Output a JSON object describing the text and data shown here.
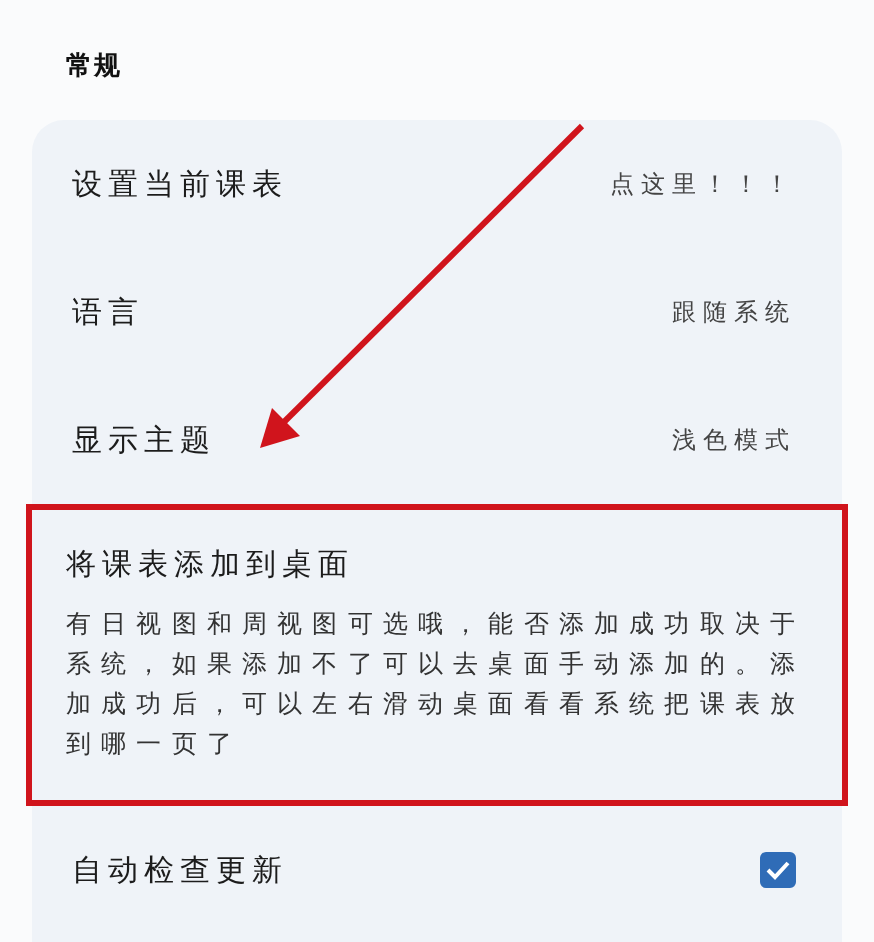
{
  "section": {
    "title": "常规"
  },
  "items": [
    {
      "kind": "value",
      "title": "设置当前课表",
      "value": "点这里！！！",
      "highlighted": false
    },
    {
      "kind": "value",
      "title": "语言",
      "value": "跟随系统",
      "highlighted": false
    },
    {
      "kind": "value",
      "title": "显示主题",
      "value": "浅色模式",
      "highlighted": false
    },
    {
      "kind": "description",
      "title": "将课表添加到桌面",
      "description": "有日视图和周视图可选哦，能否添加成功取决于系统，如果添加不了可以去桌面手动添加的。添加成功后，可以左右滑动桌面看看系统把课表放到哪一页了",
      "highlighted": true
    },
    {
      "kind": "checkbox",
      "title": "自动检查更新",
      "checked": true,
      "highlighted": false
    }
  ]
}
